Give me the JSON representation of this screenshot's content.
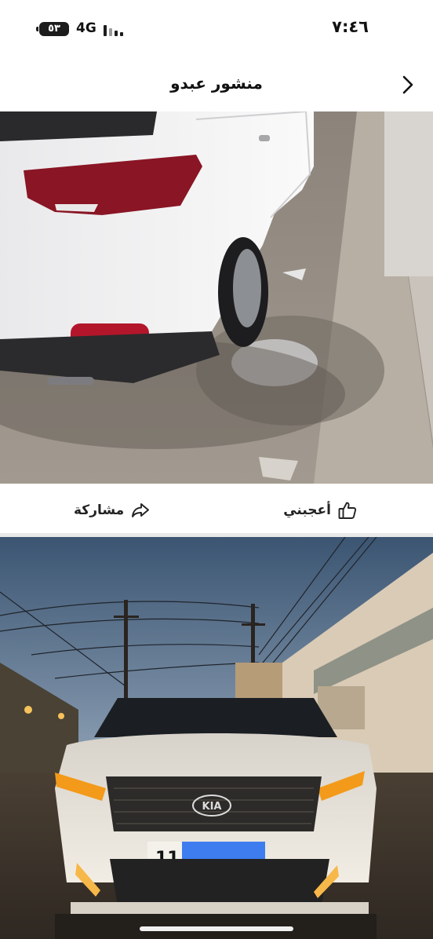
{
  "status_bar": {
    "time": "٧:٤٦",
    "battery_level": "٥٣",
    "network": "4G"
  },
  "header": {
    "title": "منشور عبدو",
    "back_icon": "chevron-right-icon"
  },
  "post": {
    "actions": {
      "like_label": "أعجبني",
      "like_icon": "thumbs-up-icon",
      "share_label": "مشاركة",
      "share_icon": "share-arrow-icon"
    },
    "photo_2": {
      "badge_text": "KIA",
      "plate_text": "11"
    }
  }
}
